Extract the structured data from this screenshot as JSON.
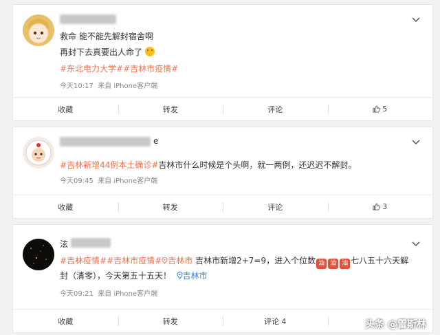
{
  "posts": [
    {
      "line1": "救命 能不能先解封宿舍啊",
      "line2": "再封下去真要出人命了",
      "topics": "#东北电力大学##吉林市疫情#",
      "time": "今天10:17",
      "source": "来自 iPhone客户端",
      "actions": {
        "collect": "收藏",
        "repost": "转发",
        "comment": "评论",
        "like_count": "5"
      }
    },
    {
      "name_tail": "e",
      "topic": "#吉林新增44例本土确诊#",
      "text": "吉林市什么时候是个头啊，就一两例，还迟迟不解封。",
      "time": "今天09:45",
      "source": "来自 iPhone客户端",
      "actions": {
        "collect": "收藏",
        "repost": "转发",
        "comment": "评论",
        "like_count": "3"
      }
    },
    {
      "name_head": "泫",
      "topics": "#吉林疫情##吉林市疫情#",
      "topic_loc": "吉林市",
      "text_a": "吉林市新增2+7=9，进入个位数",
      "qi": "加油",
      "text_b": "七八五十六天解",
      "line2": "封（清零），今天第五十五天！",
      "loc": "吉林市",
      "time": "今天09:21",
      "source": "来自 iPhone客户端",
      "actions": {
        "collect": "收藏",
        "repost": "转发",
        "comment": "评论 4",
        "like": ""
      }
    }
  ],
  "watermark": "头条 @雷斯林"
}
